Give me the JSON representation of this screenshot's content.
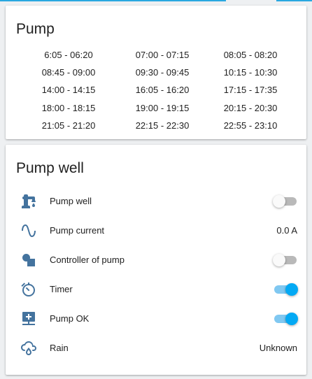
{
  "colors": {
    "accent": "#03a9f4",
    "icon": "#44739e",
    "card_background": "#ffffff",
    "page_background": "#eef0f2"
  },
  "schedule_card": {
    "title": "Pump",
    "columns": [
      [
        "6:05 - 06:20",
        "08:45 - 09:00",
        "14:00 - 14:15",
        "18:00 - 18:15",
        "21:05 - 21:20"
      ],
      [
        "07:00 - 07:15",
        "09:30 - 09:45",
        "16:05 - 16:20",
        "19:00 - 19:15",
        "22:15 - 22:30"
      ],
      [
        "08:05 - 08:20",
        "10:15 - 10:30",
        "17:15 - 17:35",
        "20:15 - 20:30",
        "22:55 - 23:10"
      ]
    ]
  },
  "entities_card": {
    "title": "Pump well",
    "rows": [
      {
        "label": "Pump well",
        "icon": "water-pump-icon",
        "control": "toggle",
        "state": "off"
      },
      {
        "label": "Pump current",
        "icon": "sine-wave-icon",
        "control": "value",
        "value": "0.0 A"
      },
      {
        "label": "Controller of pump",
        "icon": "shapes-icon",
        "control": "toggle",
        "state": "off"
      },
      {
        "label": "Timer",
        "icon": "timer-icon",
        "control": "toggle",
        "state": "on"
      },
      {
        "label": "Pump OK",
        "icon": "monitor-plus-icon",
        "control": "toggle",
        "state": "on"
      },
      {
        "label": "Rain",
        "icon": "weather-rainy-icon",
        "control": "value",
        "value": "Unknown"
      }
    ]
  }
}
